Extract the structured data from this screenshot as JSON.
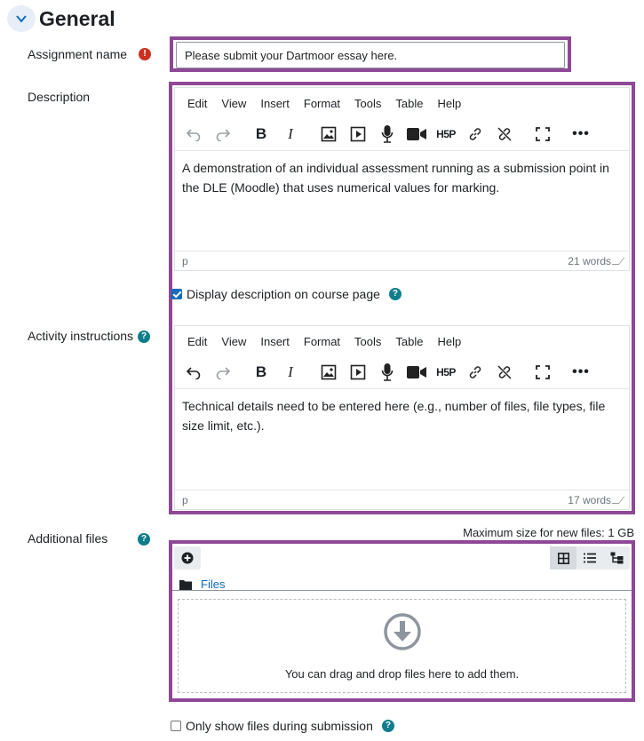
{
  "section": {
    "title": "General"
  },
  "assignment_name": {
    "label": "Assignment name",
    "value": "Please submit your Dartmoor essay here."
  },
  "description": {
    "label": "Description",
    "menu": [
      "Edit",
      "View",
      "Insert",
      "Format",
      "Tools",
      "Table",
      "Help"
    ],
    "text": "A demonstration of an individual assessment running as a submission point in the DLE (Moodle) that uses numerical values for marking.",
    "path": "p",
    "word_count": "21 words",
    "display_checkbox_label": "Display description on course page",
    "display_checked": true
  },
  "activity_instructions": {
    "label": "Activity instructions",
    "menu": [
      "Edit",
      "View",
      "Insert",
      "Format",
      "Tools",
      "Table",
      "Help"
    ],
    "text": "Technical details need to be entered here (e.g., number of files, file types, file size limit, etc.).",
    "path": "p",
    "word_count": "17 words"
  },
  "additional_files": {
    "label": "Additional files",
    "max_size": "Maximum size for new files: 1 GB",
    "folder": "Files",
    "drop_text": "You can drag and drop files here to add them.",
    "only_show_label": "Only show files during submission",
    "only_show_checked": false
  },
  "icons": {
    "required": "exclamation-icon",
    "help": "question-icon",
    "collapse": "chevron-down-icon"
  },
  "colors": {
    "highlight": "#8e4896",
    "required": "#ca3120",
    "help": "#0f7d8b",
    "link": "#0f6cbf"
  }
}
